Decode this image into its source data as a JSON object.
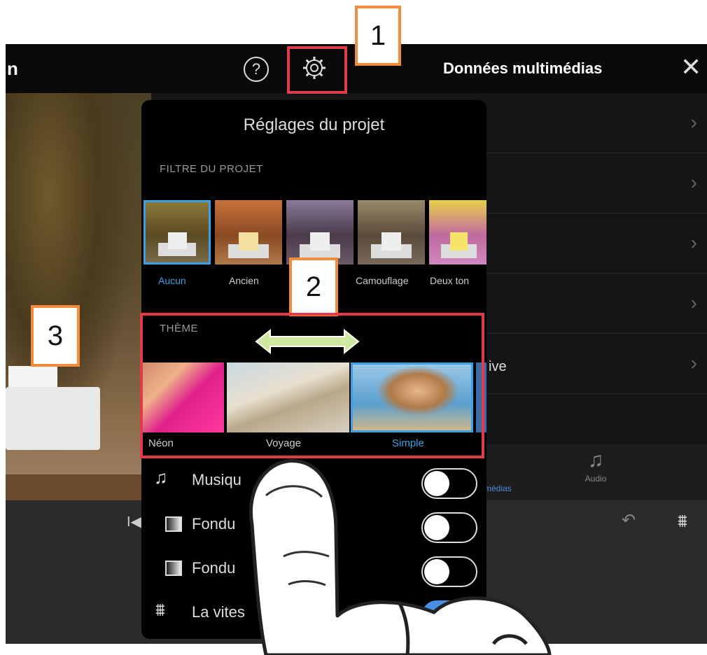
{
  "header": {
    "back_fragment": "n",
    "help_label": "?",
    "media_title": "Données multimédias",
    "close_label": "✕"
  },
  "media_list": {
    "rows": [
      {
        "label": "",
        "chevron": "›"
      },
      {
        "label": "",
        "chevron": "›"
      },
      {
        "label": "",
        "chevron": "›"
      },
      {
        "label": "",
        "chevron": "›"
      },
      {
        "label": "ive",
        "chevron": "›"
      }
    ],
    "tabs": {
      "medias_fragment": "médias",
      "audio_label": "Audio",
      "audio_icon": "♫"
    }
  },
  "popover": {
    "title": "Réglages du projet",
    "filter_section": "FILTRE DU PROJET",
    "filters": [
      {
        "name": "Aucun",
        "selected": true
      },
      {
        "name": "Ancien",
        "selected": false
      },
      {
        "name": "",
        "selected": false
      },
      {
        "name": "Camouflage",
        "selected": false
      },
      {
        "name": "Deux ton",
        "selected": false
      }
    ],
    "theme_section": "THÈME",
    "themes": [
      {
        "name": "Néon",
        "selected": false
      },
      {
        "name": "Voyage",
        "selected": false
      },
      {
        "name": "Simple",
        "selected": true
      }
    ],
    "toggles": [
      {
        "label": "Musiqu",
        "icon": "music-note-icon",
        "on": false
      },
      {
        "label": "Fondu",
        "icon": "fade-gradient-icon",
        "on": false
      },
      {
        "label": "Fondu",
        "icon": "fade-gradient-icon",
        "on": false
      },
      {
        "label": "La vites",
        "icon": "waveform-icon",
        "on": true
      }
    ]
  },
  "timeline": {
    "skip_icon": "I◀",
    "undo_icon": "↶",
    "wave_icon": "⩩"
  },
  "annotations": {
    "callout_1": "1",
    "callout_2": "2",
    "callout_3": "3"
  },
  "colors": {
    "accent": "#3aa0e8",
    "callout_border": "#f08c3c",
    "highlight_border": "#e23b48"
  }
}
